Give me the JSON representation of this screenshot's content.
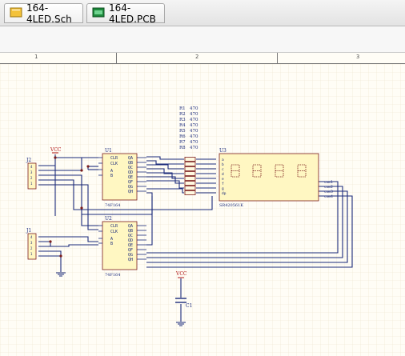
{
  "tabs": [
    {
      "label": "164-4LED.Sch",
      "icon": "schematic-doc-icon",
      "active": true
    },
    {
      "label": "164-4LED.PCB",
      "icon": "pcb-doc-icon",
      "active": false
    }
  ],
  "ruler": {
    "zones": [
      "1",
      "2",
      "3"
    ]
  },
  "schematic": {
    "resistors": [
      {
        "ref": "R1",
        "value": "470"
      },
      {
        "ref": "R2",
        "value": "470"
      },
      {
        "ref": "R3",
        "value": "470"
      },
      {
        "ref": "R4",
        "value": "470"
      },
      {
        "ref": "R5",
        "value": "470"
      },
      {
        "ref": "R6",
        "value": "470"
      },
      {
        "ref": "R7",
        "value": "470"
      },
      {
        "ref": "R8",
        "value": "470"
      }
    ],
    "u1": {
      "ref": "U1",
      "part": "74F164",
      "pins_left": [
        "CLR",
        "CLK",
        "A",
        "B"
      ],
      "pins_right": [
        "QA",
        "QB",
        "QC",
        "QD",
        "QE",
        "QF",
        "QG",
        "QH"
      ]
    },
    "u2": {
      "ref": "U2",
      "part": "74F164",
      "pins_left": [
        "CLR",
        "CLK",
        "A",
        "B"
      ],
      "pins_right": [
        "QA",
        "QB",
        "QC",
        "QD",
        "QE",
        "QF",
        "QG",
        "QH"
      ]
    },
    "u3": {
      "ref": "U3",
      "part": "SR420561K",
      "pins_left": [
        "a",
        "b",
        "c",
        "d",
        "e",
        "f",
        "g",
        "dp"
      ],
      "pins_right": [
        "com1",
        "com2",
        "com3",
        "com4"
      ]
    },
    "j1": {
      "ref": "J1"
    },
    "j2": {
      "ref": "J2"
    },
    "c1": {
      "ref": "C1"
    },
    "power": {
      "label": "VCC"
    }
  }
}
